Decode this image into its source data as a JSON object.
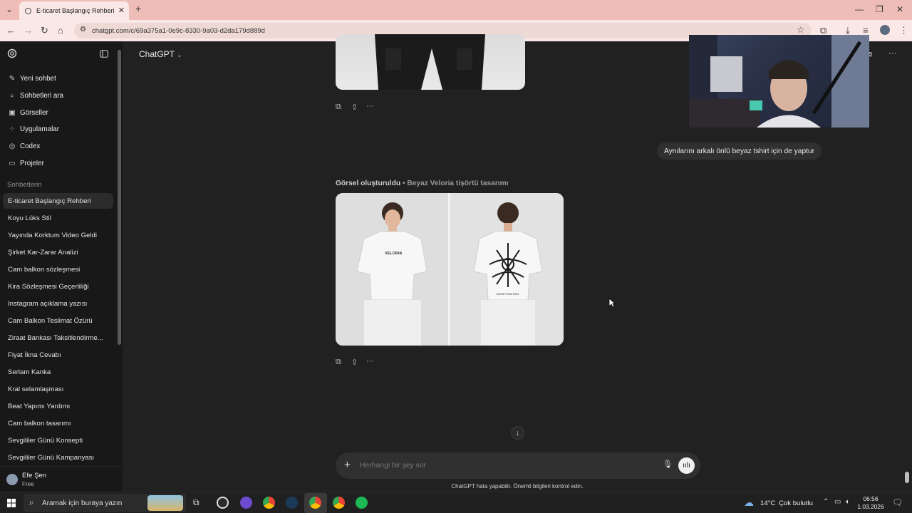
{
  "browser": {
    "tab_title": "E-ticaret Başlangıç Rehberi",
    "url": "chatgpt.com/c/69a375a1-0e9c-8330-9a03-d2da179d889d"
  },
  "sidebar": {
    "nav": [
      {
        "label": "Yeni sohbet",
        "icon": "edit-icon"
      },
      {
        "label": "Sohbetleri ara",
        "icon": "search-icon"
      },
      {
        "label": "Görseller",
        "icon": "image-icon"
      },
      {
        "label": "Uygulamalar",
        "icon": "apps-icon"
      },
      {
        "label": "Codex",
        "icon": "codex-icon"
      },
      {
        "label": "Projeler",
        "icon": "folder-icon"
      }
    ],
    "section_title": "Sohbetlerin",
    "chats": [
      "E-ticaret Başlangıç Rehberi",
      "Koyu Lüks Stil",
      "Yayında Korktum Video Geldi",
      "Şirket Kar-Zarar Analizi",
      "Cam balkon sözleşmesi",
      "Kira Sözleşmesi Geçerliliği",
      "Instagram açıklama yazısı",
      "Cam Balkon Teslimat Özürü",
      "Ziraat Bankası Taksitlendirme...",
      "Fiyat İkna Cevabı",
      "Serlam Kanka",
      "Kral selamlaşması",
      "Beat Yapımı Yardımı",
      "Cam balkon tasarımı",
      "Sevgililer Günü Konsepti",
      "Sevgililer Günü Kampanyası"
    ],
    "user": {
      "name": "Efe Şen",
      "plan": "Free"
    }
  },
  "header": {
    "model": "ChatGPT",
    "share_partial": "laş"
  },
  "conversation": {
    "user_message": "Aynılarını arkalı önlü beyaz tshirt için de yaptur",
    "image_title": "Görsel oluşturuldu",
    "image_subtitle": "• Beyaz Veloria tişörtü tasarımı",
    "tshirt_front_text": "VELORIA",
    "tshirt_back_text": "BORN FROM PAIN"
  },
  "composer": {
    "placeholder": "Herhangi bir şey sor",
    "disclaimer": "ChatGPT hata yapabilir. Önemli bilgileri kontrol edin."
  },
  "taskbar": {
    "search_placeholder": "Aramak için buraya yazın",
    "weather_temp": "14°C",
    "weather_desc": "Çok bulutlu",
    "time": "06:56",
    "date": "1.03.2026"
  },
  "colors": {
    "accent_user_bubble": "#303030",
    "sidebar_bg": "#181818",
    "main_bg": "#212121",
    "tab_bar": "#eebdb8"
  }
}
